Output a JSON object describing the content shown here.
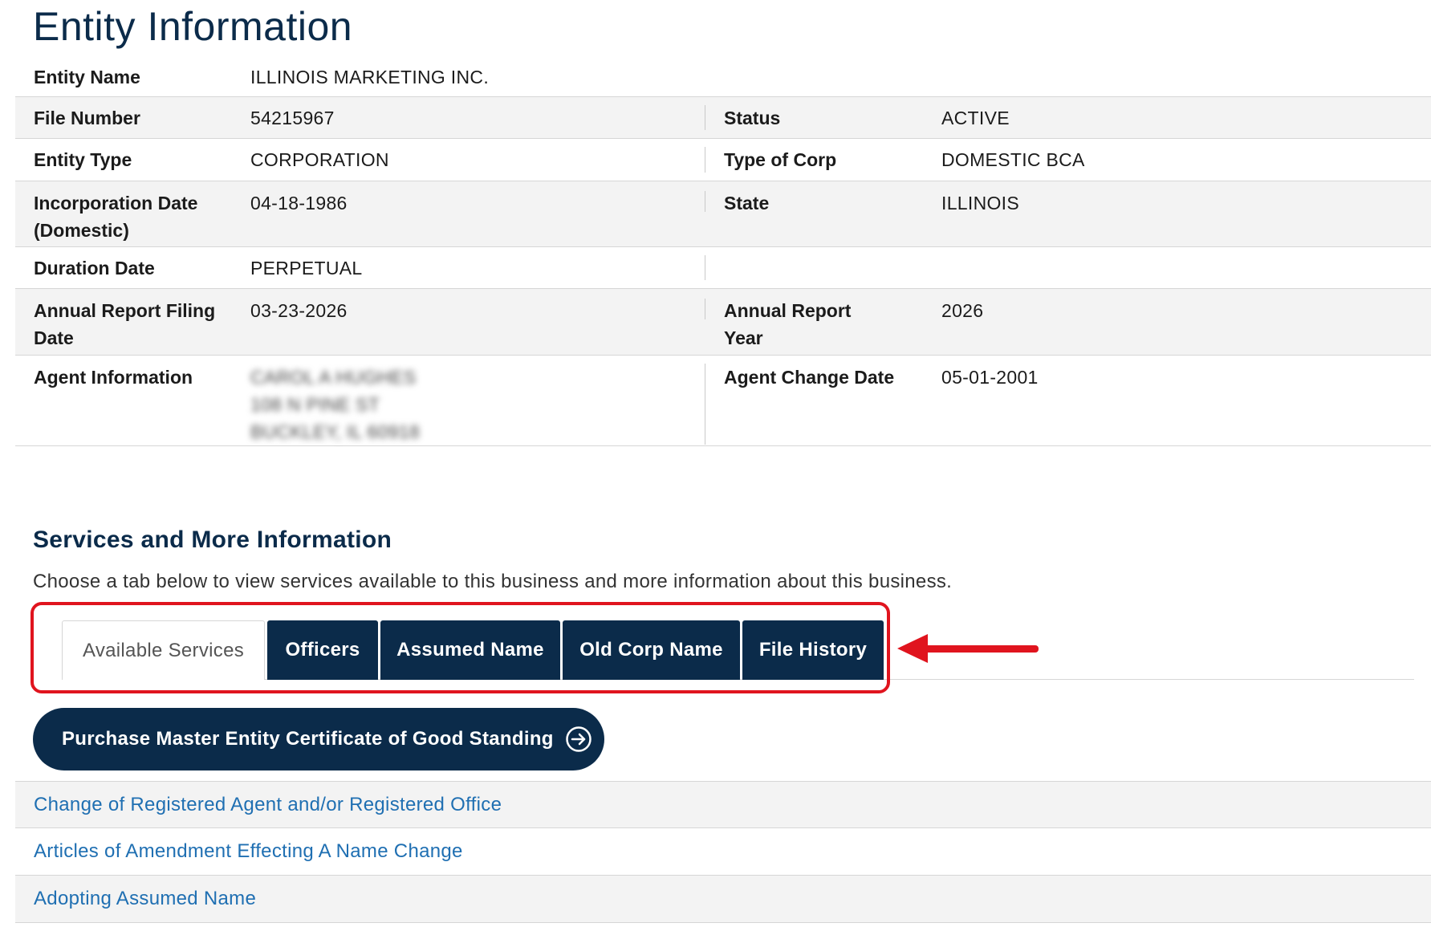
{
  "page": {
    "title": "Entity Information"
  },
  "entity": {
    "name_label": "Entity Name",
    "name_value": "ILLINOIS MARKETING INC.",
    "file_number_label": "File Number",
    "file_number_value": "54215967",
    "status_label": "Status",
    "status_value": "ACTIVE",
    "entity_type_label": "Entity Type",
    "entity_type_value": "CORPORATION",
    "type_of_corp_label": "Type of Corp",
    "type_of_corp_value": "DOMESTIC BCA",
    "incorporation_label_line1": "Incorporation Date",
    "incorporation_label_line2": "(Domestic)",
    "incorporation_value": "04-18-1986",
    "state_label": "State",
    "state_value": "ILLINOIS",
    "duration_label": "Duration Date",
    "duration_value": "PERPETUAL",
    "annual_filing_label_line1": "Annual Report Filing",
    "annual_filing_label_line2": "Date",
    "annual_filing_value": "03-23-2026",
    "annual_year_label_line1": "Annual Report",
    "annual_year_label_line2": "Year",
    "annual_year_value": "2026",
    "agent_label": "Agent Information",
    "agent_lines": [
      "CAROL A HUGHES",
      "108 N PINE ST",
      "BUCKLEY, IL 60918"
    ],
    "agent_change_label": "Agent Change Date",
    "agent_change_value": "05-01-2001"
  },
  "services": {
    "title": "Services and More Information",
    "description": "Choose a tab below to view services available to this business and more information about this business.",
    "tabs": [
      {
        "label": "Available Services",
        "active": true
      },
      {
        "label": "Officers",
        "active": false
      },
      {
        "label": "Assumed Name",
        "active": false
      },
      {
        "label": "Old Corp Name",
        "active": false
      },
      {
        "label": "File History",
        "active": false
      }
    ],
    "purchase_button": "Purchase Master Entity Certificate of Good Standing",
    "links": [
      "Change of Registered Agent and/or Registered Office",
      "Articles of Amendment Effecting A Name Change",
      "Adopting Assumed Name"
    ]
  },
  "colors": {
    "navy": "#0b2b4a",
    "link_blue": "#1f6fb2",
    "highlight_red": "#e0141e",
    "row_alt": "#f3f3f3"
  },
  "icons": {
    "purchase_button_icon": "circle-arrow-right-icon",
    "annotation": "red-arrow-left-icon"
  }
}
